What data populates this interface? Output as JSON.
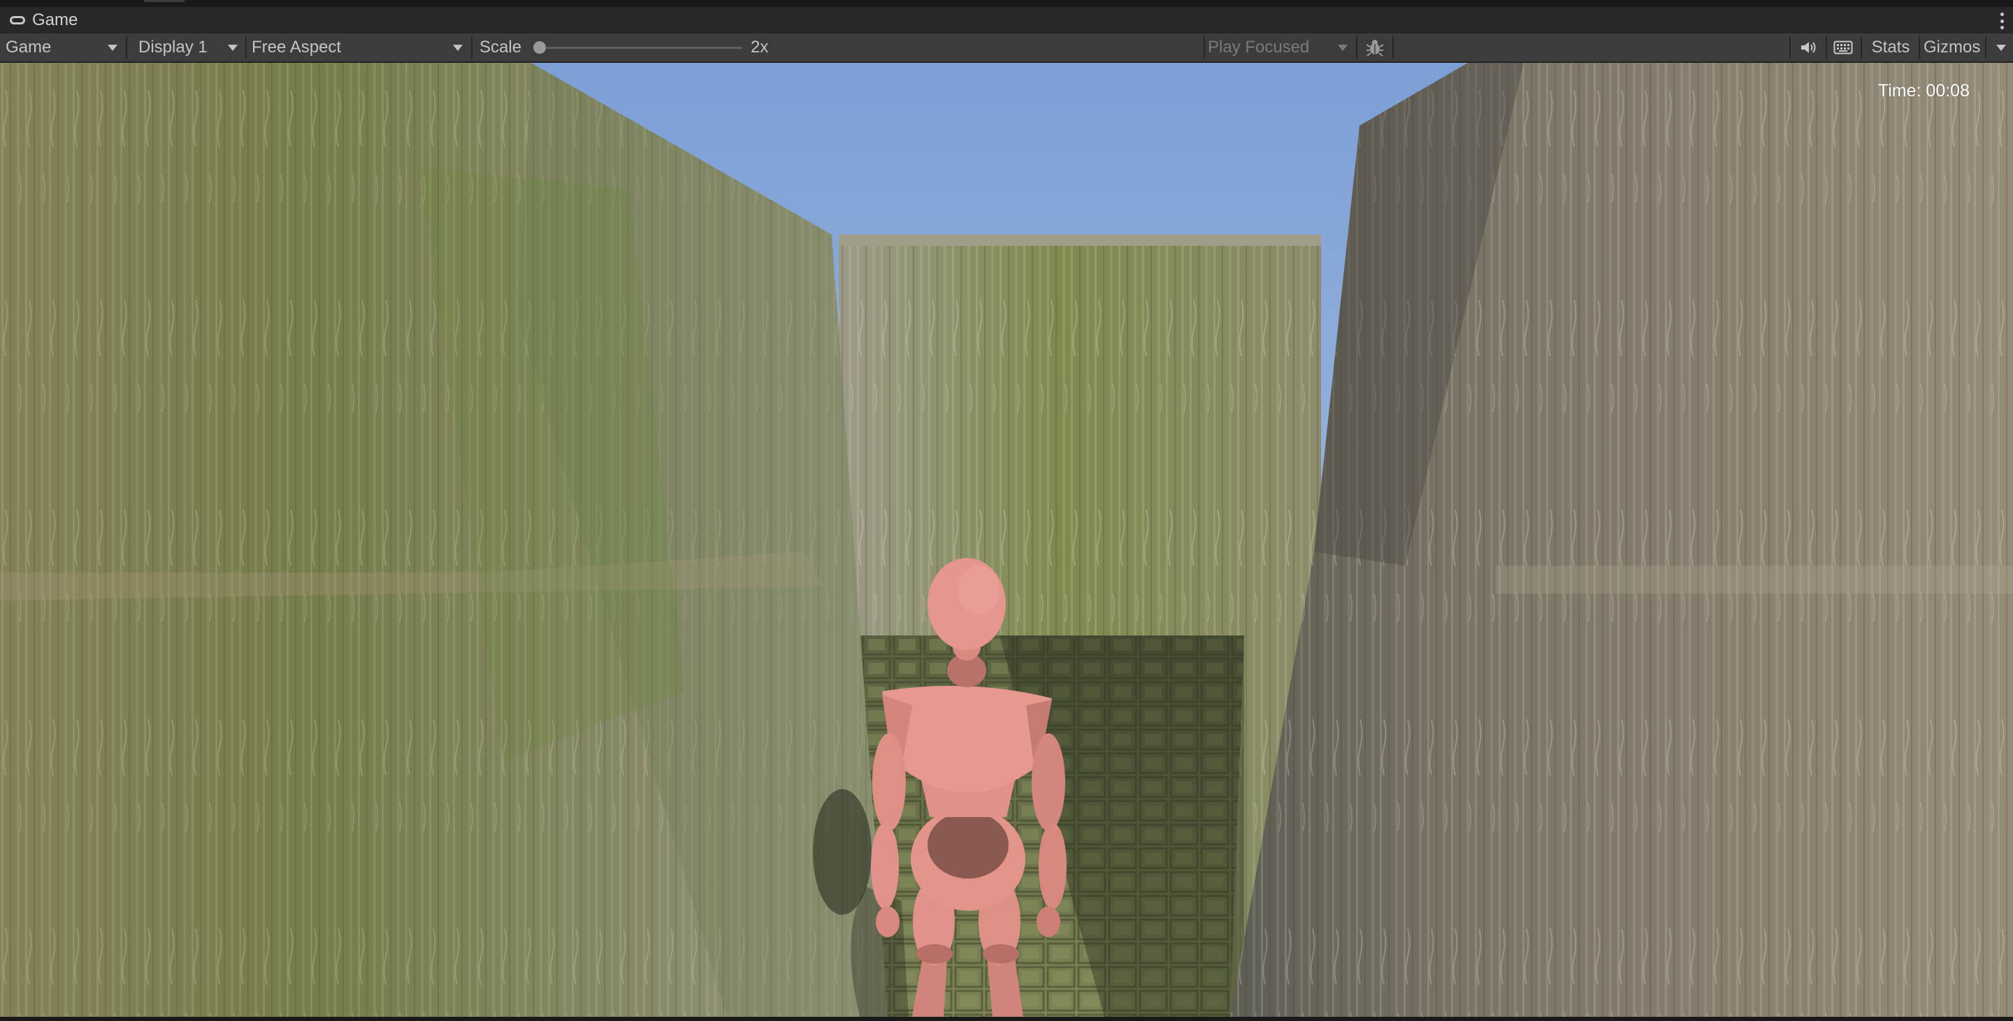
{
  "tab": {
    "title": "Game",
    "icon": "gamepad-icon"
  },
  "toolbar": {
    "view_mode": "Game",
    "display": "Display 1",
    "aspect": "Free Aspect",
    "scale_label": "Scale",
    "scale_value": "2x",
    "scale_level": 0.0,
    "play_mode": "Play Focused",
    "stats_label": "Stats",
    "gizmos_label": "Gizmos"
  },
  "hud": {
    "time_text": "Time: 00:08"
  },
  "colors": {
    "sky_top": "#7c9fd6",
    "sky_bottom": "#b5c8e4",
    "wall_left": "#857a5a",
    "wall_right": "#8a8170",
    "floor": "#6c7a4c",
    "character_skin": "#e3948b"
  }
}
